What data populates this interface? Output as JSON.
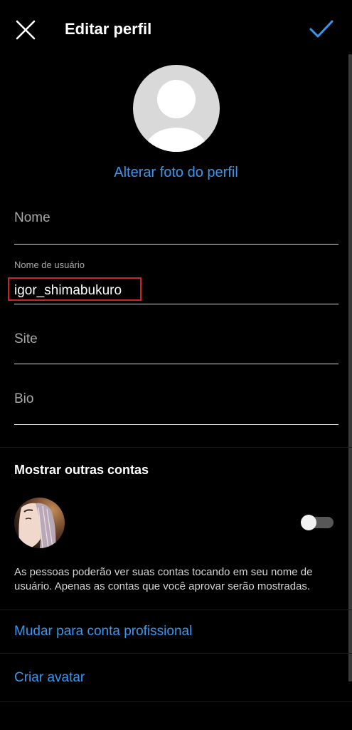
{
  "header": {
    "title": "Editar perfil",
    "close_icon": "close-icon",
    "confirm_icon": "checkmark-icon"
  },
  "profile": {
    "change_photo_label": "Alterar foto do perfil"
  },
  "form": {
    "name_placeholder": "Nome",
    "username_label": "Nome de usuário",
    "username_value": "igor_shimabukuro",
    "site_placeholder": "Site",
    "bio_placeholder": "Bio"
  },
  "other_accounts": {
    "title": "Mostrar outras contas",
    "toggle_on": false,
    "info": "As pessoas poderão ver suas contas tocando em seu nome de usuário. Apenas as contas que você aprovar serão mostradas."
  },
  "links": {
    "professional": "Mudar para conta profissional",
    "avatar": "Criar avatar"
  },
  "colors": {
    "background": "#000000",
    "accent": "#3797f0",
    "highlight": "#d0202a"
  }
}
